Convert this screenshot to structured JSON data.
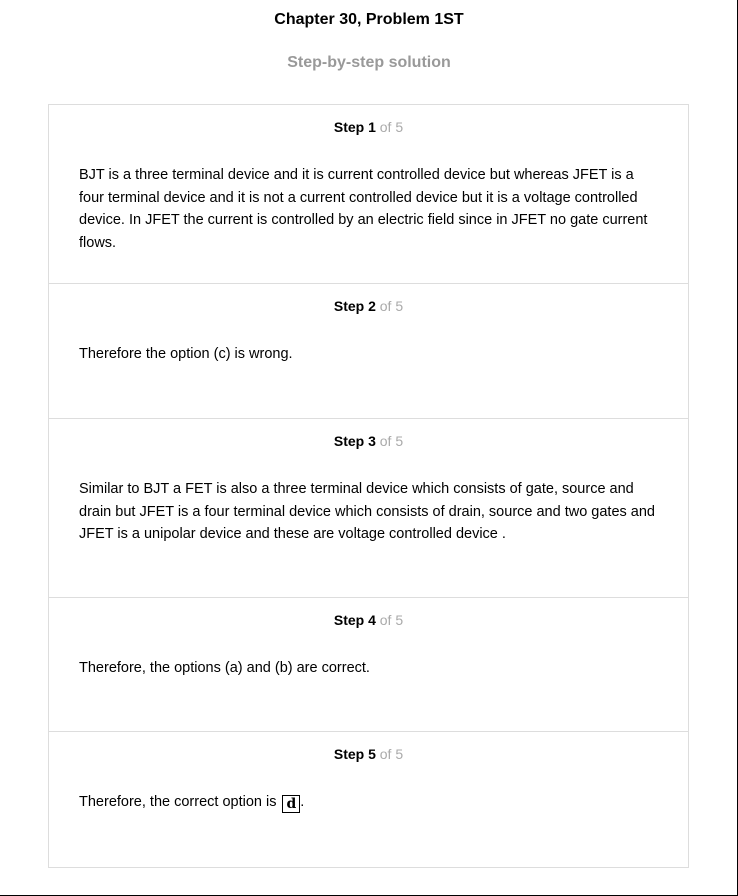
{
  "header": {
    "chapter_title": "Chapter 30, Problem 1ST",
    "subtitle": "Step-by-step solution"
  },
  "steps": [
    {
      "label": "Step 1",
      "of": "of 5",
      "text": "BJT is a three terminal device and it is current controlled device but whereas JFET is a four terminal device and it is not a current controlled device but it is a voltage controlled device. In JFET the current is controlled by an electric field since in JFET no gate current flows."
    },
    {
      "label": "Step 2",
      "of": "of 5",
      "text": "Therefore the option (c) is wrong."
    },
    {
      "label": "Step 3",
      "of": "of 5",
      "text": "Similar to BJT a FET is also a three terminal device which consists of gate, source and drain but JFET is a four terminal device which consists of drain, source and two gates and JFET is a unipolar device and these are voltage controlled device ."
    },
    {
      "label": "Step 4",
      "of": "of 5",
      "text": "Therefore, the options (a) and (b) are correct."
    },
    {
      "label": "Step 5",
      "of": "of 5",
      "text": "Therefore, the correct option is",
      "answer": "d",
      "trailing": "."
    }
  ]
}
